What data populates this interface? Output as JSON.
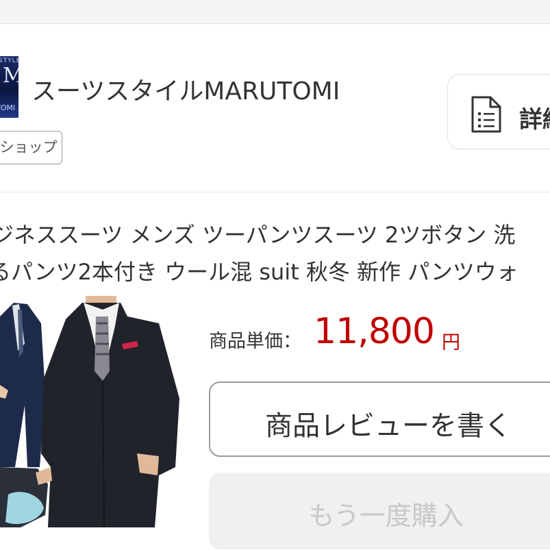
{
  "shop": {
    "name": "スーツスタイルMARUTOMI",
    "tag": "ショップ",
    "logo_text_top": "STYLE-",
    "logo_letter": "M",
    "logo_text_bottom": "TOMI"
  },
  "detail_button": {
    "label": "詳細",
    "icon": "document-icon"
  },
  "product": {
    "title_line1": "ジネススーツ メンズ ツーパンツスーツ 2ツボタン 洗",
    "title_line2": "るパンツ2本付き ウール混 suit 秋冬 新作 パンツウォ",
    "image_alt": "suit product photo"
  },
  "price": {
    "label": "商品単価：",
    "value": "11,800",
    "unit": "円",
    "color": "#bf0000"
  },
  "buttons": {
    "review": "商品レビューを書く",
    "rebuy": "もう一度購入"
  }
}
